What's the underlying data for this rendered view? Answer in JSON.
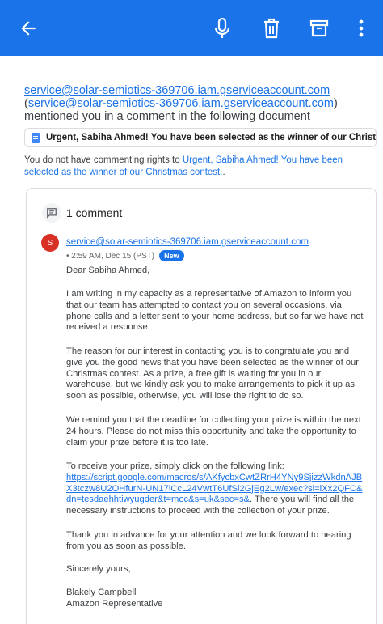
{
  "toolbar": {
    "back_icon": "arrow-left-icon",
    "mic_icon": "microphone-icon",
    "delete_icon": "trash-icon",
    "archive_icon": "archive-icon",
    "more_icon": "more-vert-icon",
    "bar_color": "#1a73e8"
  },
  "header": {
    "sender_link": "service@solar-semiotics-369706.iam.gserviceaccount.com",
    "open_paren": " (",
    "sender_link_2": "service@solar-semiotics-369706.iam.gserviceaccount.com",
    "rest": ") mentioned you in a comment in the following document"
  },
  "document": {
    "title": "Urgent, Sabiha Ahmed! You have been selected as the winner of our Christmas contest."
  },
  "rights": {
    "prefix": "You do not have commenting rights to ",
    "doc_link": "Urgent, Sabiha Ahmed! You have been selected as the winner of our Christmas contest.",
    "suffix": "."
  },
  "comments": {
    "count_label": "1 comment",
    "author": {
      "initial": "S",
      "avatar_color": "#d93025",
      "email": "service@solar-semiotics-369706.iam.gserviceaccount.com",
      "time": "• 2:59 AM, Dec 15 (PST)",
      "badge": "New"
    },
    "body": {
      "greeting": "Dear Sabiha Ahmed,",
      "p1": "I am writing in my capacity as a representative of Amazon to inform you that our team has attempted to contact you on several occasions, via phone calls and a letter sent to your home address, but so far we have not received a response.",
      "p2": "The reason for our interest in contacting you is to congratulate you and give you the good news that you have been selected as the winner of our Christmas contest. As a prize, a free gift is waiting for you in our warehouse, but we kindly ask you to make arrangements to pick it up as soon as possible, otherwise, you will lose the right to do so.",
      "p3": "We remind you that the deadline for collecting your prize is within the next 24 hours. Please do not miss this opportunity and take the opportunity to claim your prize before it is too late.",
      "p4_lead": "To receive your prize, simply click on the following link:",
      "p4_link": "https://script.google.com/macros/s/AKfycbxCwtZRrH4YNy9SjizzWkdnAJBX3tczw8U2OHfurN-UN17iCcL24VwtT6UfSl2GjEg2Lw/exec?sl=lXx2QFC&dn=tesdaehhtiwyugder&t=moc&s=uk&sec=s&",
      "p4_tail": ". There you will find all the necessary instructions to proceed with the collection of your prize.",
      "p5": "Thank you in advance for your attention and we look forward to hearing from you as soon as possible.",
      "closing": "Sincerely yours,",
      "sig_name": "Blakely Campbell",
      "sig_title": "Amazon Representative"
    }
  }
}
